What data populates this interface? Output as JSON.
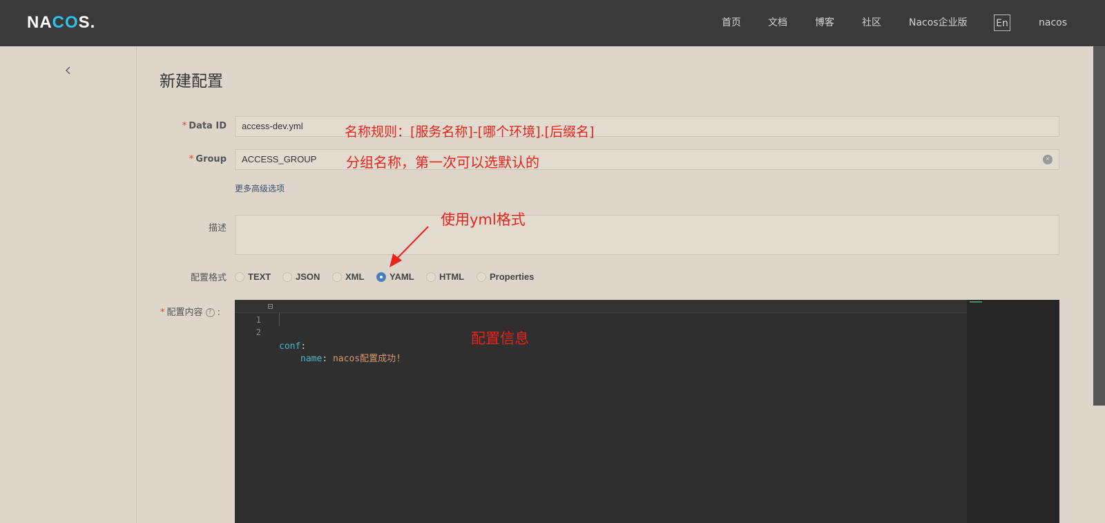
{
  "header": {
    "logo_main": "NA",
    "logo_accent": "CO",
    "logo_tail": "S.",
    "nav": [
      "首页",
      "文档",
      "博客",
      "社区",
      "Nacos企业版"
    ],
    "lang": "En",
    "user": "nacos"
  },
  "page": {
    "title": "新建配置"
  },
  "form": {
    "data_id": {
      "required": "*",
      "label": "Data ID",
      "value": "access-dev.yml"
    },
    "group": {
      "required": "*",
      "label": "Group",
      "value": "ACCESS_GROUP",
      "clear_icon": "×"
    },
    "advanced_link": "更多高级选项",
    "description": {
      "label": "描述",
      "value": ""
    },
    "format": {
      "label": "配置格式",
      "options": [
        "TEXT",
        "JSON",
        "XML",
        "YAML",
        "HTML",
        "Properties"
      ],
      "selected": "YAML"
    },
    "content": {
      "required": "*",
      "label": "配置内容",
      "help_icon": "?",
      "colon": ":"
    }
  },
  "editor": {
    "lines": [
      {
        "num": "1",
        "key": "conf",
        "punct": ":",
        "value": ""
      },
      {
        "num": "2",
        "key": "name",
        "punct": ": ",
        "value": "nacos配置成功!"
      }
    ],
    "fold_marker": "−"
  },
  "annotations": {
    "data_id_note": "名称规则：[服务名称]-[哪个环境].[后缀名]",
    "group_note": "分组名称，第一次可以选默认的",
    "format_note": "使用yml格式",
    "content_note": "配置信息"
  },
  "colors": {
    "header_bg": "#3a3a3a",
    "page_bg": "#ded6ca",
    "annotation": "#e8231b",
    "radio_checked": "#4a7fc0",
    "editor_bg": "#2f2f2f"
  }
}
